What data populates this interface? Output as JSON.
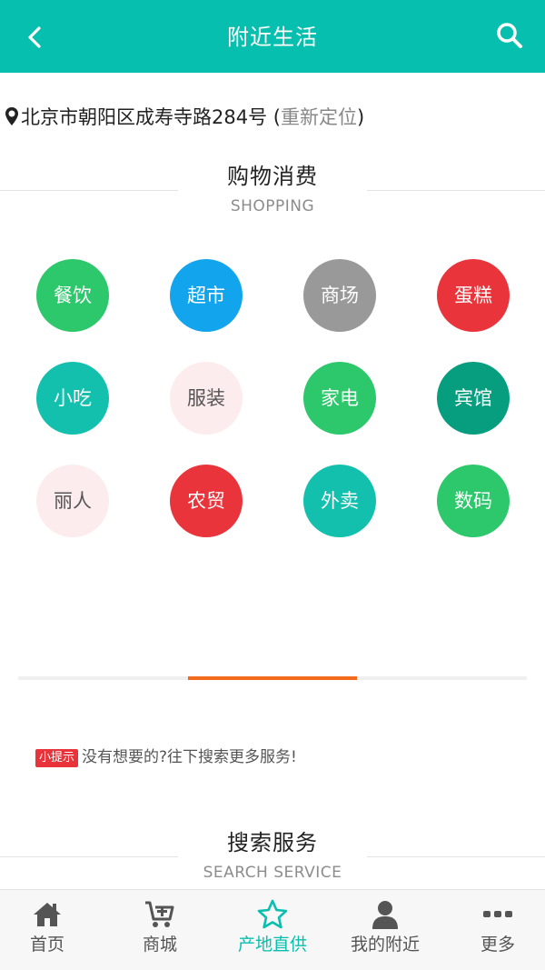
{
  "header": {
    "title": "附近生活"
  },
  "location": {
    "address": "北京市朝阳区成寿寺路284号",
    "open_paren": " (",
    "relocate": "重新定位",
    "close_paren": ")"
  },
  "shopping": {
    "title": "购物消费",
    "subtitle": "SHOPPING",
    "categories": [
      {
        "label": "餐饮",
        "color": "#2dc86b"
      },
      {
        "label": "超市",
        "color": "#12a4ec"
      },
      {
        "label": "商场",
        "color": "#999999"
      },
      {
        "label": "蛋糕",
        "color": "#e8343a"
      },
      {
        "label": "小吃",
        "color": "#12c0ad"
      },
      {
        "label": "服装",
        "color": "#fdeced"
      },
      {
        "label": "家电",
        "color": "#2dc86b"
      },
      {
        "label": "宾馆",
        "color": "#079e80"
      },
      {
        "label": "丽人",
        "color": "#fdeced"
      },
      {
        "label": "农贸",
        "color": "#e8343a"
      },
      {
        "label": "外卖",
        "color": "#12c0ad"
      },
      {
        "label": "数码",
        "color": "#2dc86b"
      }
    ]
  },
  "pager": {
    "accent": "#f26a1b"
  },
  "tip": {
    "badge": "小提示",
    "text": "没有想要的?往下搜索更多服务!"
  },
  "search_service": {
    "title": "搜索服务",
    "subtitle": "SEARCH SERVICE"
  },
  "tabbar": {
    "items": [
      {
        "label": "首页",
        "icon": "home-icon"
      },
      {
        "label": "商城",
        "icon": "cart-plus-icon"
      },
      {
        "label": "产地直供",
        "icon": "star-icon"
      },
      {
        "label": "我的附近",
        "icon": "user-icon"
      },
      {
        "label": "更多",
        "icon": "more-icon"
      }
    ],
    "active_index": 2,
    "active_color": "#07bfae"
  },
  "colors": {
    "brand": "#07bfae"
  }
}
